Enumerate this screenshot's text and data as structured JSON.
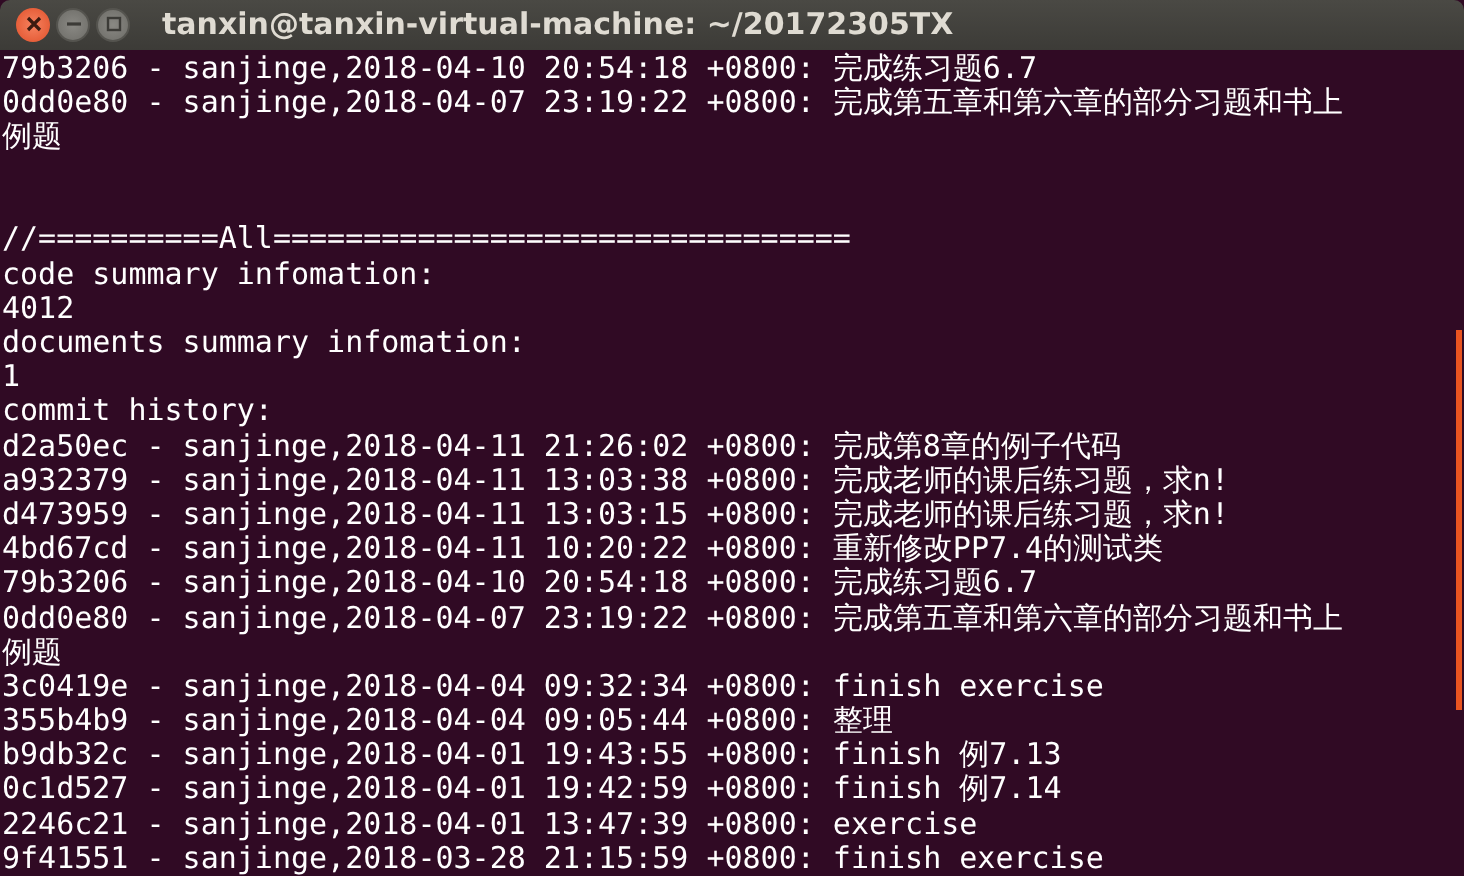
{
  "window": {
    "title": "tanxin@tanxin-virtual-machine: ~/20172305TX",
    "controls": [
      {
        "kind": "close"
      },
      {
        "kind": "minimize"
      },
      {
        "kind": "maximize"
      }
    ]
  },
  "lines": [
    {
      "kind": "text",
      "text": "79b3206 - sanjinge,2018-04-10 20:54:18 +0800: 完成练习题6.7"
    },
    {
      "kind": "text",
      "text": "0dd0e80 - sanjinge,2018-04-07 23:19:22 +0800: 完成第五章和第六章的部分习题和书上"
    },
    {
      "kind": "text",
      "text": "例题"
    },
    {
      "kind": "blank"
    },
    {
      "kind": "blank"
    },
    {
      "kind": "text",
      "text": "//==========All================================"
    },
    {
      "kind": "text",
      "text": "code summary infomation:"
    },
    {
      "kind": "text",
      "text": "4012"
    },
    {
      "kind": "text",
      "text": "documents summary infomation:"
    },
    {
      "kind": "text",
      "text": "1"
    },
    {
      "kind": "text",
      "text": "commit history:"
    },
    {
      "kind": "text",
      "text": "d2a50ec - sanjinge,2018-04-11 21:26:02 +0800: 完成第8章的例子代码"
    },
    {
      "kind": "text",
      "text": "a932379 - sanjinge,2018-04-11 13:03:38 +0800: 完成老师的课后练习题，求n!"
    },
    {
      "kind": "text",
      "text": "d473959 - sanjinge,2018-04-11 13:03:15 +0800: 完成老师的课后练习题，求n!"
    },
    {
      "kind": "text",
      "text": "4bd67cd - sanjinge,2018-04-11 10:20:22 +0800: 重新修改PP7.4的测试类"
    },
    {
      "kind": "text",
      "text": "79b3206 - sanjinge,2018-04-10 20:54:18 +0800: 完成练习题6.7"
    },
    {
      "kind": "text",
      "text": "0dd0e80 - sanjinge,2018-04-07 23:19:22 +0800: 完成第五章和第六章的部分习题和书上"
    },
    {
      "kind": "text",
      "text": "例题"
    },
    {
      "kind": "text",
      "text": "3c0419e - sanjinge,2018-04-04 09:32:34 +0800: finish exercise"
    },
    {
      "kind": "text",
      "text": "355b4b9 - sanjinge,2018-04-04 09:05:44 +0800: 整理"
    },
    {
      "kind": "text",
      "text": "b9db32c - sanjinge,2018-04-01 19:43:55 +0800: finish 例7.13"
    },
    {
      "kind": "text",
      "text": "0c1d527 - sanjinge,2018-04-01 19:42:59 +0800: finish 例7.14"
    },
    {
      "kind": "text",
      "text": "2246c21 - sanjinge,2018-04-01 13:47:39 +0800: exercise"
    },
    {
      "kind": "text",
      "text": "9f41551 - sanjinge,2018-03-28 21:15:59 +0800: finish exercise"
    }
  ]
}
